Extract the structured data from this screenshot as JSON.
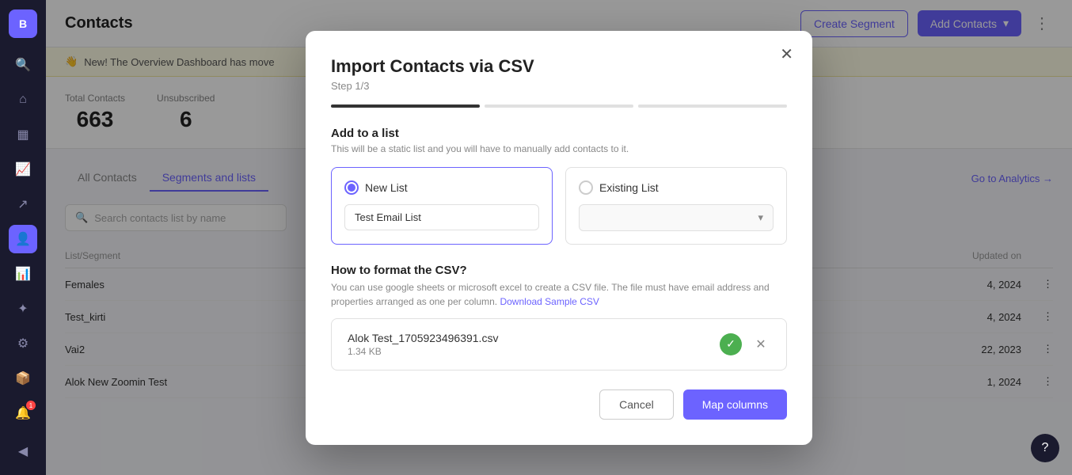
{
  "sidebar": {
    "logo": "B",
    "items": [
      {
        "id": "search",
        "icon": "🔍",
        "active": false
      },
      {
        "id": "home",
        "icon": "⌂",
        "active": false
      },
      {
        "id": "grid",
        "icon": "▦",
        "active": false
      },
      {
        "id": "chart",
        "icon": "📈",
        "active": false
      },
      {
        "id": "share",
        "icon": "↗",
        "active": false
      },
      {
        "id": "contacts",
        "icon": "👤",
        "active": true
      },
      {
        "id": "analytics",
        "icon": "📊",
        "active": false
      },
      {
        "id": "magic",
        "icon": "✦",
        "active": false
      },
      {
        "id": "settings",
        "icon": "⚙",
        "active": false
      },
      {
        "id": "box",
        "icon": "📦",
        "active": false
      },
      {
        "id": "bell",
        "icon": "🔔",
        "active": false,
        "badge": "1"
      }
    ],
    "bottom_item": {
      "id": "collapse",
      "icon": "◀"
    }
  },
  "header": {
    "title": "Contacts",
    "create_segment_label": "Create Segment",
    "add_contacts_label": "Add Contacts",
    "more_icon": "⋮"
  },
  "notification": {
    "emoji": "👋",
    "text": "New! The Overview Dashboard has move"
  },
  "stats": [
    {
      "label": "Total Contacts",
      "value": "663"
    },
    {
      "label": "Unsubscribed",
      "value": "6"
    }
  ],
  "tabs": [
    {
      "id": "all-contacts",
      "label": "All Contacts",
      "active": false
    },
    {
      "id": "segments-lists",
      "label": "Segments and lists",
      "active": true
    }
  ],
  "analytics_link": "Go to Analytics →",
  "search": {
    "placeholder": "Search contacts list by name"
  },
  "table": {
    "columns": [
      {
        "id": "list-segment",
        "label": "List/Segment"
      },
      {
        "id": "updated-on",
        "label": "Updated on"
      }
    ],
    "rows": [
      {
        "name": "Females",
        "date": "4, 2024"
      },
      {
        "name": "Test_kirti",
        "date": "4, 2024"
      },
      {
        "name": "Vai2",
        "date": "22, 2023"
      },
      {
        "name": "Alok New Zoomin Test",
        "date": "1, 2024"
      }
    ]
  },
  "modal": {
    "title": "Import Contacts via CSV",
    "step": "Step 1/3",
    "close_icon": "✕",
    "progress": [
      {
        "active": true
      },
      {
        "active": false
      },
      {
        "active": false
      }
    ],
    "add_to_list": {
      "title": "Add to a list",
      "description": "This will be a static list and you will have to manually add contacts to it.",
      "new_list": {
        "label": "New List",
        "value": "Test Email List",
        "selected": true
      },
      "existing_list": {
        "label": "Existing List",
        "placeholder": "",
        "selected": false
      }
    },
    "csv_section": {
      "title": "How to format the CSV?",
      "description": "You can use google sheets or microsoft excel to create a CSV file. The file must have email address and properties arranged as one per column.",
      "download_link": "Download Sample CSV",
      "file": {
        "name": "Alok Test_1705923496391.csv",
        "size": "1.34 KB",
        "check_icon": "✓",
        "remove_icon": "✕"
      }
    },
    "footer": {
      "cancel_label": "Cancel",
      "map_label": "Map columns"
    }
  },
  "help": {
    "icon": "?"
  }
}
